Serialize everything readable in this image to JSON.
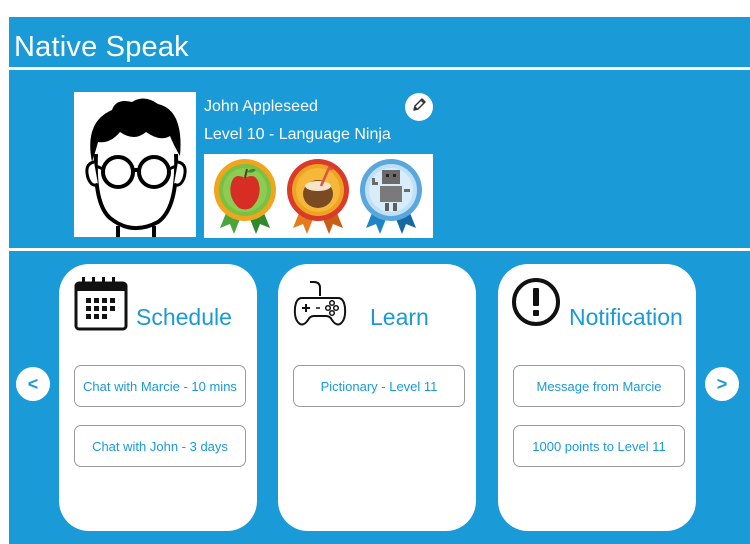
{
  "app": {
    "title": "Native Speak"
  },
  "profile": {
    "name": "John Appleseed",
    "level": "Level 10 - Language Ninja",
    "badges": [
      "apple-badge-icon",
      "coconut-badge-icon",
      "robot-badge-icon"
    ]
  },
  "cards": [
    {
      "title": "Schedule",
      "icon": "calendar-icon",
      "items": [
        "Chat with Marcie - 10 mins",
        "Chat with John - 3 days"
      ]
    },
    {
      "title": "Learn",
      "icon": "gamepad-icon",
      "items": [
        "Pictionary - Level 11"
      ]
    },
    {
      "title": "Notification",
      "icon": "exclamation-icon",
      "items": [
        "Message from Marcie",
        "1000 points to Level 11"
      ]
    }
  ],
  "nav": {
    "prev": "<",
    "next": ">"
  },
  "colors": {
    "accent": "#1a9ad6",
    "background": "#ffffff"
  }
}
